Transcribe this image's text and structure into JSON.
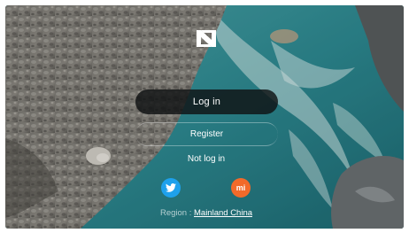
{
  "auth": {
    "login_label": "Log in",
    "register_label": "Register",
    "not_login_label": "Not log in"
  },
  "social": {
    "twitter_icon": "twitter-bird-icon",
    "mi_icon": "mi-icon",
    "mi_glyph": "mi"
  },
  "region": {
    "prefix": "Region : ",
    "value": "Mainland China"
  },
  "colors": {
    "twitter": "#1ea1ec",
    "mi": "#f26a2a",
    "water": "#2c8a94",
    "rocks": "#8b8a84"
  }
}
